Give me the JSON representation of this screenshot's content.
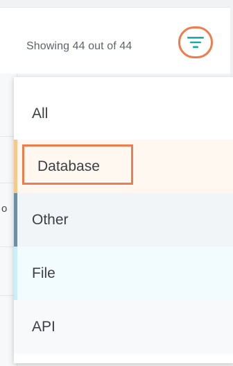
{
  "header": {
    "showing_text": "Showing 44 out of 44",
    "filter_icon": "filter-icon"
  },
  "background": {
    "fragment": "o"
  },
  "filter_menu": {
    "items": [
      {
        "label": "All",
        "accent": ""
      },
      {
        "label": "Database",
        "accent": "#f5c98b",
        "selected": true
      },
      {
        "label": "Other",
        "accent": "#6e8fa3"
      },
      {
        "label": "File",
        "accent": "#cbeef8"
      },
      {
        "label": "API",
        "accent": ""
      }
    ]
  },
  "colors": {
    "highlight": "#ed7d4f",
    "filter_icon": "#1aa9a6"
  }
}
